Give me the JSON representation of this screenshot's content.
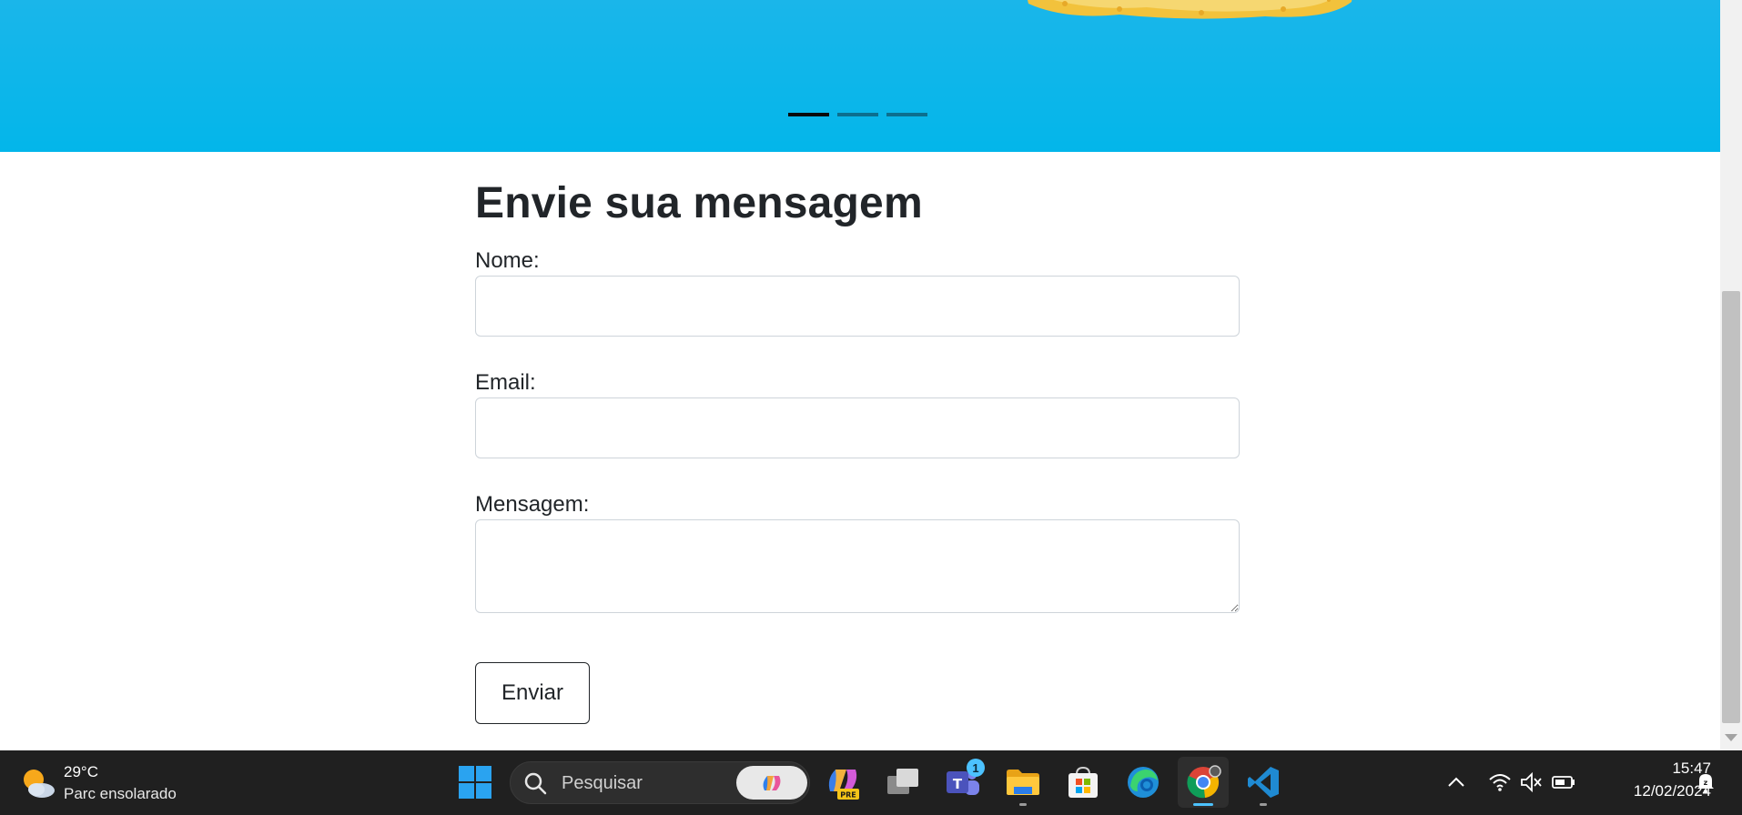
{
  "carousel": {
    "indicators": [
      {
        "label": "Slide 1",
        "active": true
      },
      {
        "label": "Slide 2",
        "active": false
      },
      {
        "label": "Slide 3",
        "active": false
      }
    ],
    "background_color": "#03b6ea"
  },
  "contact_form": {
    "title": "Envie sua mensagem",
    "name_label": "Nome:",
    "name_value": "",
    "email_label": "Email:",
    "email_value": "",
    "message_label": "Mensagem:",
    "message_value": "",
    "submit_label": "Enviar"
  },
  "taskbar": {
    "weather": {
      "temperature": "29°C",
      "description": "Parc ensolarado",
      "icon": "partly-sunny-icon"
    },
    "search": {
      "placeholder": "Pesquisar"
    },
    "apps": [
      {
        "name": "start",
        "icon": "windows-start-icon"
      },
      {
        "name": "copilot-preview",
        "icon": "copilot-pre-icon",
        "badge_text": "PRE"
      },
      {
        "name": "task-view",
        "icon": "task-view-icon"
      },
      {
        "name": "teams",
        "icon": "teams-icon",
        "badge": "1"
      },
      {
        "name": "file-explorer",
        "icon": "folder-icon",
        "running": true
      },
      {
        "name": "microsoft-store",
        "icon": "store-icon"
      },
      {
        "name": "edge",
        "icon": "edge-icon"
      },
      {
        "name": "chrome",
        "icon": "chrome-icon",
        "running": true,
        "active": true
      },
      {
        "name": "vscode",
        "icon": "vscode-icon",
        "running": true
      }
    ],
    "tray": {
      "icons": [
        "chevron-up-icon",
        "wifi-icon",
        "speaker-muted-icon",
        "battery-icon"
      ],
      "time": "15:47",
      "date": "12/02/2024",
      "notification_icon": "notification-dnd-icon"
    }
  }
}
